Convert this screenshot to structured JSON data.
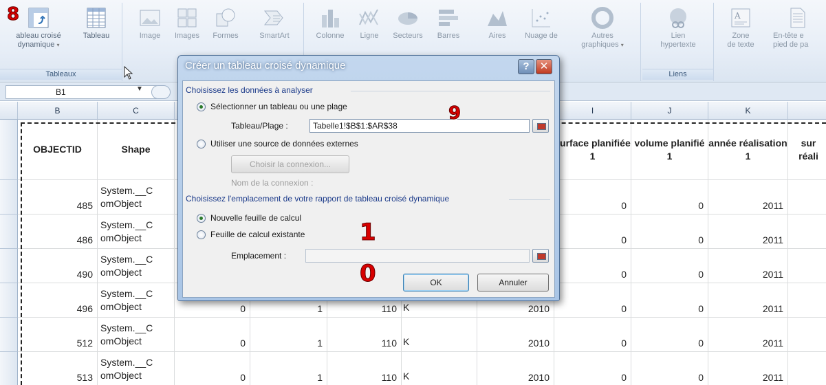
{
  "annotations": [
    "8",
    "9",
    "1",
    "0"
  ],
  "ribbon": {
    "groups": [
      {
        "name": "Tableaux",
        "buttons": [
          {
            "label": "ableau croisé",
            "label2": "dynamique",
            "icon": "pivot-table-icon"
          },
          {
            "label": "Tableau",
            "icon": "table-icon"
          }
        ]
      },
      {
        "name": "",
        "buttons": [
          {
            "label": "Image",
            "icon": "picture-icon"
          },
          {
            "label": "Images",
            "icon": "clipart-icon"
          },
          {
            "label": "Formes",
            "icon": "shapes-icon"
          },
          {
            "label": "SmartArt",
            "icon": "smartart-icon"
          }
        ]
      },
      {
        "name": "",
        "buttons": [
          {
            "label": "Colonne",
            "icon": "column-chart-icon"
          },
          {
            "label": "Ligne",
            "icon": "line-chart-icon"
          },
          {
            "label": "Secteurs",
            "icon": "pie-chart-icon"
          },
          {
            "label": "Barres",
            "icon": "bar-chart-icon"
          },
          {
            "label": "Aires",
            "icon": "area-chart-icon"
          },
          {
            "label": "Nuage de",
            "icon": "scatter-chart-icon"
          },
          {
            "label": "Autres",
            "label2": "graphiques",
            "icon": "other-charts-icon"
          }
        ]
      },
      {
        "name": "Liens",
        "buttons": [
          {
            "label": "Lien",
            "label2": "hypertexte",
            "icon": "hyperlink-icon"
          }
        ]
      },
      {
        "name": "",
        "buttons": [
          {
            "label": "Zone",
            "label2": "de texte",
            "icon": "text-box-icon"
          },
          {
            "label": "En-tête e",
            "label2": "pied de pa",
            "icon": "header-footer-icon"
          }
        ]
      }
    ]
  },
  "formula_bar": {
    "name_box": "B1"
  },
  "sheet": {
    "columns": [
      "B",
      "C",
      "I",
      "J",
      "K"
    ],
    "headers": {
      "B": "OBJECTID",
      "C": "Shape",
      "I": "surface planifiée 1",
      "J": "volume planifié 1",
      "K": "année réalisation 1",
      "L": "sur réali"
    },
    "rows": [
      {
        "objectid": "485",
        "shape1": "System.__C",
        "shape2": "omObject",
        "d": "",
        "e": "",
        "f": "",
        "g": "",
        "h": "",
        "i": "0",
        "j": "0",
        "k": "2011"
      },
      {
        "objectid": "486",
        "shape1": "System.__C",
        "shape2": "omObject",
        "d": "",
        "e": "",
        "f": "",
        "g": "",
        "h": "",
        "i": "0",
        "j": "0",
        "k": "2011"
      },
      {
        "objectid": "490",
        "shape1": "System.__C",
        "shape2": "omObject",
        "d": "",
        "e": "",
        "f": "",
        "g": "",
        "h": "",
        "i": "0",
        "j": "0",
        "k": "2011"
      },
      {
        "objectid": "496",
        "shape1": "System.__C",
        "shape2": "omObject",
        "d": "0",
        "e": "1",
        "f": "110",
        "g": "K",
        "h": "2010",
        "i": "0",
        "j": "0",
        "k": "2011"
      },
      {
        "objectid": "512",
        "shape1": "System.__C",
        "shape2": "omObject",
        "d": "0",
        "e": "1",
        "f": "110",
        "g": "K",
        "h": "2010",
        "i": "0",
        "j": "0",
        "k": "2011"
      },
      {
        "objectid": "513",
        "shape1": "System.__C",
        "shape2": "omObject",
        "d": "0",
        "e": "1",
        "f": "110",
        "g": "K",
        "h": "2010",
        "i": "0",
        "j": "0",
        "k": "2011"
      }
    ]
  },
  "dialog": {
    "title": "Créer un tableau croisé dynamique",
    "help": "?",
    "close": "✕",
    "section1": "Choisissez les données à analyser",
    "opt_select": "Sélectionner un tableau ou une plage",
    "range_label": "Tableau/Plage :",
    "range_value": "Tabelle1!$B$1:$AR$38",
    "opt_external": "Utiliser une source de données externes",
    "choose_conn": "Choisir la connexion...",
    "conn_name": "Nom de la connexion :",
    "section2": "Choisissez l'emplacement de votre rapport de tableau croisé dynamique",
    "opt_new_sheet": "Nouvelle feuille de calcul",
    "opt_existing_sheet": "Feuille de calcul existante",
    "location_label": "Emplacement :",
    "location_value": "",
    "ok": "OK",
    "cancel": "Annuler"
  }
}
